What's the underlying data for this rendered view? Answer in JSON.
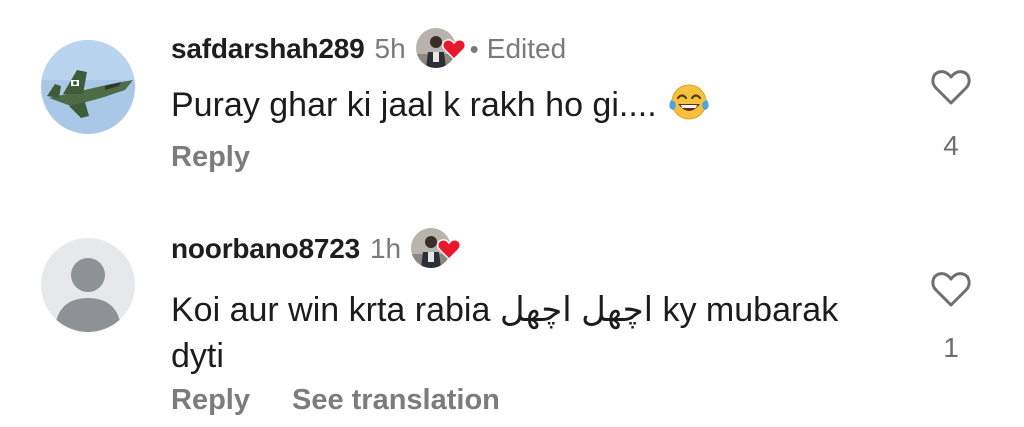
{
  "comments": [
    {
      "username": "safdarshah289",
      "time": "5h",
      "separator": "•",
      "edited": "Edited",
      "text": "Puray ghar ki jaal k rakh ho gi....",
      "emoji_icon": "face-with-tears-of-joy-icon",
      "reply_label": "Reply",
      "like_count": "4"
    },
    {
      "username": "noorbano8723",
      "time": "1h",
      "text": "Koi aur win krta rabia اچھل اچھل  ky mubarak dyti",
      "reply_label": "Reply",
      "see_translation_label": "See translation",
      "like_count": "1"
    }
  ],
  "colors": {
    "heart": "#e8192c",
    "muted": "#7a7a7a",
    "avatar_default_bg": "#e6e8ec",
    "avatar_default_fg": "#8e9196",
    "jet_sky": "#a9c8e8",
    "jet_body": "#4d6b45"
  }
}
